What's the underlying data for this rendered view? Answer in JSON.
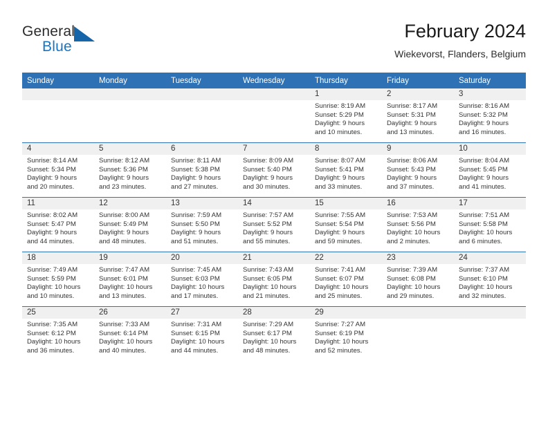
{
  "brand": {
    "name_part1": "General",
    "name_part2": "Blue",
    "flag_icon": "blue-flag-triangle",
    "accent_color": "#1874c4"
  },
  "header": {
    "title": "February 2024",
    "subtitle": "Wiekevorst, Flanders, Belgium"
  },
  "theme": {
    "header_blue": "#2e72b5",
    "band_grey": "#f0f0f0",
    "text": "#333333"
  },
  "weekday_headers": [
    "Sunday",
    "Monday",
    "Tuesday",
    "Wednesday",
    "Thursday",
    "Friday",
    "Saturday"
  ],
  "weeks": [
    [
      {
        "day": "",
        "empty": true
      },
      {
        "day": "",
        "empty": true
      },
      {
        "day": "",
        "empty": true
      },
      {
        "day": "",
        "empty": true
      },
      {
        "day": "1",
        "sunrise": "Sunrise: 8:19 AM",
        "sunset": "Sunset: 5:29 PM",
        "daylight_line1": "Daylight: 9 hours",
        "daylight_line2": "and 10 minutes."
      },
      {
        "day": "2",
        "sunrise": "Sunrise: 8:17 AM",
        "sunset": "Sunset: 5:31 PM",
        "daylight_line1": "Daylight: 9 hours",
        "daylight_line2": "and 13 minutes."
      },
      {
        "day": "3",
        "sunrise": "Sunrise: 8:16 AM",
        "sunset": "Sunset: 5:32 PM",
        "daylight_line1": "Daylight: 9 hours",
        "daylight_line2": "and 16 minutes."
      }
    ],
    [
      {
        "day": "4",
        "sunrise": "Sunrise: 8:14 AM",
        "sunset": "Sunset: 5:34 PM",
        "daylight_line1": "Daylight: 9 hours",
        "daylight_line2": "and 20 minutes."
      },
      {
        "day": "5",
        "sunrise": "Sunrise: 8:12 AM",
        "sunset": "Sunset: 5:36 PM",
        "daylight_line1": "Daylight: 9 hours",
        "daylight_line2": "and 23 minutes."
      },
      {
        "day": "6",
        "sunrise": "Sunrise: 8:11 AM",
        "sunset": "Sunset: 5:38 PM",
        "daylight_line1": "Daylight: 9 hours",
        "daylight_line2": "and 27 minutes."
      },
      {
        "day": "7",
        "sunrise": "Sunrise: 8:09 AM",
        "sunset": "Sunset: 5:40 PM",
        "daylight_line1": "Daylight: 9 hours",
        "daylight_line2": "and 30 minutes."
      },
      {
        "day": "8",
        "sunrise": "Sunrise: 8:07 AM",
        "sunset": "Sunset: 5:41 PM",
        "daylight_line1": "Daylight: 9 hours",
        "daylight_line2": "and 33 minutes."
      },
      {
        "day": "9",
        "sunrise": "Sunrise: 8:06 AM",
        "sunset": "Sunset: 5:43 PM",
        "daylight_line1": "Daylight: 9 hours",
        "daylight_line2": "and 37 minutes."
      },
      {
        "day": "10",
        "sunrise": "Sunrise: 8:04 AM",
        "sunset": "Sunset: 5:45 PM",
        "daylight_line1": "Daylight: 9 hours",
        "daylight_line2": "and 41 minutes."
      }
    ],
    [
      {
        "day": "11",
        "sunrise": "Sunrise: 8:02 AM",
        "sunset": "Sunset: 5:47 PM",
        "daylight_line1": "Daylight: 9 hours",
        "daylight_line2": "and 44 minutes."
      },
      {
        "day": "12",
        "sunrise": "Sunrise: 8:00 AM",
        "sunset": "Sunset: 5:49 PM",
        "daylight_line1": "Daylight: 9 hours",
        "daylight_line2": "and 48 minutes."
      },
      {
        "day": "13",
        "sunrise": "Sunrise: 7:59 AM",
        "sunset": "Sunset: 5:50 PM",
        "daylight_line1": "Daylight: 9 hours",
        "daylight_line2": "and 51 minutes."
      },
      {
        "day": "14",
        "sunrise": "Sunrise: 7:57 AM",
        "sunset": "Sunset: 5:52 PM",
        "daylight_line1": "Daylight: 9 hours",
        "daylight_line2": "and 55 minutes."
      },
      {
        "day": "15",
        "sunrise": "Sunrise: 7:55 AM",
        "sunset": "Sunset: 5:54 PM",
        "daylight_line1": "Daylight: 9 hours",
        "daylight_line2": "and 59 minutes."
      },
      {
        "day": "16",
        "sunrise": "Sunrise: 7:53 AM",
        "sunset": "Sunset: 5:56 PM",
        "daylight_line1": "Daylight: 10 hours",
        "daylight_line2": "and 2 minutes."
      },
      {
        "day": "17",
        "sunrise": "Sunrise: 7:51 AM",
        "sunset": "Sunset: 5:58 PM",
        "daylight_line1": "Daylight: 10 hours",
        "daylight_line2": "and 6 minutes."
      }
    ],
    [
      {
        "day": "18",
        "sunrise": "Sunrise: 7:49 AM",
        "sunset": "Sunset: 5:59 PM",
        "daylight_line1": "Daylight: 10 hours",
        "daylight_line2": "and 10 minutes."
      },
      {
        "day": "19",
        "sunrise": "Sunrise: 7:47 AM",
        "sunset": "Sunset: 6:01 PM",
        "daylight_line1": "Daylight: 10 hours",
        "daylight_line2": "and 13 minutes."
      },
      {
        "day": "20",
        "sunrise": "Sunrise: 7:45 AM",
        "sunset": "Sunset: 6:03 PM",
        "daylight_line1": "Daylight: 10 hours",
        "daylight_line2": "and 17 minutes."
      },
      {
        "day": "21",
        "sunrise": "Sunrise: 7:43 AM",
        "sunset": "Sunset: 6:05 PM",
        "daylight_line1": "Daylight: 10 hours",
        "daylight_line2": "and 21 minutes."
      },
      {
        "day": "22",
        "sunrise": "Sunrise: 7:41 AM",
        "sunset": "Sunset: 6:07 PM",
        "daylight_line1": "Daylight: 10 hours",
        "daylight_line2": "and 25 minutes."
      },
      {
        "day": "23",
        "sunrise": "Sunrise: 7:39 AM",
        "sunset": "Sunset: 6:08 PM",
        "daylight_line1": "Daylight: 10 hours",
        "daylight_line2": "and 29 minutes."
      },
      {
        "day": "24",
        "sunrise": "Sunrise: 7:37 AM",
        "sunset": "Sunset: 6:10 PM",
        "daylight_line1": "Daylight: 10 hours",
        "daylight_line2": "and 32 minutes."
      }
    ],
    [
      {
        "day": "25",
        "sunrise": "Sunrise: 7:35 AM",
        "sunset": "Sunset: 6:12 PM",
        "daylight_line1": "Daylight: 10 hours",
        "daylight_line2": "and 36 minutes."
      },
      {
        "day": "26",
        "sunrise": "Sunrise: 7:33 AM",
        "sunset": "Sunset: 6:14 PM",
        "daylight_line1": "Daylight: 10 hours",
        "daylight_line2": "and 40 minutes."
      },
      {
        "day": "27",
        "sunrise": "Sunrise: 7:31 AM",
        "sunset": "Sunset: 6:15 PM",
        "daylight_line1": "Daylight: 10 hours",
        "daylight_line2": "and 44 minutes."
      },
      {
        "day": "28",
        "sunrise": "Sunrise: 7:29 AM",
        "sunset": "Sunset: 6:17 PM",
        "daylight_line1": "Daylight: 10 hours",
        "daylight_line2": "and 48 minutes."
      },
      {
        "day": "29",
        "sunrise": "Sunrise: 7:27 AM",
        "sunset": "Sunset: 6:19 PM",
        "daylight_line1": "Daylight: 10 hours",
        "daylight_line2": "and 52 minutes."
      },
      {
        "day": "",
        "empty": true
      },
      {
        "day": "",
        "empty": true
      }
    ]
  ]
}
